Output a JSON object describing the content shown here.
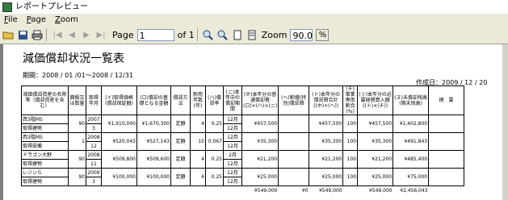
{
  "window": {
    "title": "レポートプレビュー"
  },
  "menu": {
    "file": "File",
    "page": "Page",
    "zoom": "Zoom",
    "file_key": "F",
    "page_key": "P",
    "zoom_key": "Z"
  },
  "toolbar": {
    "page_label": "Page",
    "page_value": "1",
    "of_label": "of 1",
    "zoom_label": "Zoom",
    "zoom_value": "90.0",
    "percent": "%"
  },
  "report": {
    "title": "減価償却状況一覧表",
    "period": "期間：2008 / 01 /01～2008 / 12/31",
    "created": "作成日：2009 / 12 / 20",
    "headers": [
      "減価償却資産の名称等（償却資産を含む）",
      "面積又は数量",
      "取得年月",
      "(イ)取得価格(償却保証額)",
      "(ロ)償却の基礎となる金額",
      "償却方法",
      "耐用年数(年)",
      "(ハ)償却率",
      "(ニ)本年中の償却期間",
      "(ホ)本年分の普通償却費(ロ)×(ハ)×(ニ)",
      "(ヘ)割増(特別)償却費",
      "(ト)本年分の償却費合計((ホ)+(ヘ))",
      "(チ)事業専用割合(%)",
      "(リ)本年分の必要経費算入額((ト)×(チ))",
      "(ヌ)未償却残高(期末残高)",
      "摘　要"
    ],
    "rows": [
      {
        "name1": "西3階MS",
        "name2": "取得建物",
        "qty": "90",
        "ym1": "2007",
        "ym2": "3",
        "cost": "¥1,910,000",
        "base": "¥1,670,300",
        "method": "定額",
        "life": "4",
        "rate": "0.25",
        "per1": "12月",
        "per2": "12月",
        "normal": "¥457,500",
        "special": "",
        "total": "¥457,500",
        "biz": "100",
        "expense": "¥457,500",
        "remain": "¥1,402,800",
        "note": ""
      },
      {
        "name1": "西3階MS",
        "name2": "取得設備",
        "qty": "1",
        "ym1": "2008",
        "ym2": "12",
        "cost": "¥520,043",
        "base": "¥527,143",
        "method": "定額",
        "life": "15",
        "rate": "0.067",
        "per1": "12月",
        "per2": "12月",
        "normal": "¥35,300",
        "special": "",
        "total": "¥35,300",
        "biz": "100",
        "expense": "¥35,300",
        "remain": "¥491,843",
        "note": ""
      },
      {
        "name1": "ドラゴン大野",
        "name2": "取得建物",
        "qty": "90",
        "ym1": "2008",
        "ym2": "11",
        "cost": "¥509,800",
        "base": "¥509,600",
        "method": "定額",
        "life": "4",
        "rate": "0.25",
        "per1": "2月",
        "per2": "12月",
        "normal": "¥21,200",
        "special": "",
        "total": "¥21,200",
        "biz": "100",
        "expense": "¥21,200",
        "remain": "¥485,400",
        "note": ""
      },
      {
        "name1": "レジンら",
        "name2": "取得建物",
        "qty": "90",
        "ym1": "2009",
        "ym2": "3",
        "cost": "¥100,000",
        "base": "¥100,000",
        "method": "定額",
        "life": "4",
        "rate": "0.25",
        "per1": "12月",
        "per2": "12月",
        "normal": "¥25,000",
        "special": "",
        "total": "¥25,000",
        "biz": "100",
        "expense": "¥25,000",
        "remain": "¥75,000",
        "note": ""
      }
    ],
    "totals": {
      "normal": "¥549,000",
      "special": "¥0",
      "total": "¥549,000",
      "expense": "¥549,000",
      "remain": "¥2,456,043"
    }
  }
}
